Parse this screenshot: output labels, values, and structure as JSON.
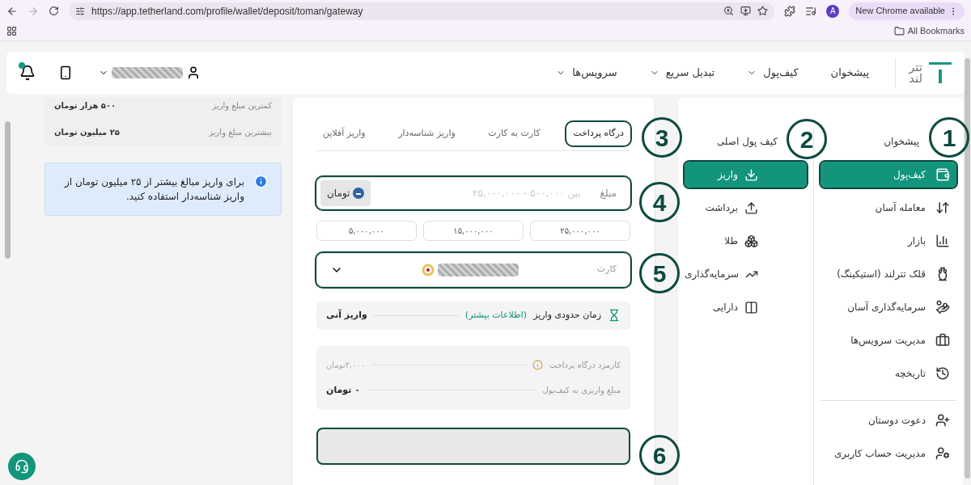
{
  "browser": {
    "url": "https://app.tetherland.com/profile/wallet/deposit/toman/gateway",
    "profile_initial": "A",
    "update_button": "New Chrome available",
    "bookmarks": "All Bookmarks"
  },
  "header": {
    "logo": [
      "تتر",
      "لند"
    ],
    "notification_dot": true,
    "nav": [
      {
        "label": "پیشخوان",
        "dropdown": false
      },
      {
        "label": "کیف‌پول",
        "dropdown": true
      },
      {
        "label": "تبدیل سریع",
        "dropdown": true
      },
      {
        "label": "سرویس‌ها",
        "dropdown": true
      }
    ]
  },
  "sidebar": {
    "items": [
      {
        "label": "پیشخوان",
        "selected": false
      },
      {
        "label": "کیف‌پول",
        "selected": true
      },
      {
        "label": "معامله آسان",
        "selected": false
      },
      {
        "label": "بازار",
        "selected": false
      },
      {
        "label": "قلک تترلند (استیکینگ)",
        "selected": false
      },
      {
        "label": "سرمایه‌گذاری آسان",
        "selected": false
      },
      {
        "label": "مدیریت سرویس‌ها",
        "selected": false
      },
      {
        "label": "تاریخچه",
        "selected": false
      }
    ],
    "bottom_items": [
      {
        "label": "دعوت دوستان"
      },
      {
        "label": "مدیریت حساب کاربری"
      }
    ]
  },
  "submenu": {
    "title": "کیف پول اصلی",
    "items": [
      {
        "label": "واریز",
        "selected": true
      },
      {
        "label": "برداشت",
        "selected": false
      },
      {
        "label": "طلا",
        "selected": false
      },
      {
        "label": "سرمایه‌گذاری",
        "selected": false
      },
      {
        "label": "دارایی",
        "selected": false
      }
    ]
  },
  "tabs": [
    {
      "label": "درگاه پرداخت",
      "selected": true
    },
    {
      "label": "کارت به کارت",
      "selected": false
    },
    {
      "label": "واریز شناسه‌دار",
      "selected": false
    },
    {
      "label": "واریز آفلاین",
      "selected": false
    }
  ],
  "amount_field": {
    "label": "مبلغ",
    "placeholder": "بین ۵۰۰,۰۰۰ - ۲۵,۰۰۰,۰۰۰",
    "currency": "تومان"
  },
  "presets": [
    "۲۵,۰۰۰,۰۰۰",
    "۱۵,۰۰۰,۰۰۰",
    "۵,۰۰۰,۰۰۰"
  ],
  "card_select": {
    "label": "کارت"
  },
  "eta": {
    "label": "زمان حدودی واریز",
    "link": "(اطلاعات بیشتر)",
    "value": "واریز آنی"
  },
  "summary": [
    {
      "label": "کارمزد درگاه پرداخت",
      "value": "۴,۰۰۰تومان",
      "muted": true,
      "info": true
    },
    {
      "label": "مبلغ واریزی به کیف‌پول",
      "value": "۰ تومان",
      "muted": false,
      "info": false
    }
  ],
  "submit": {
    "disabled": true
  },
  "limits": [
    {
      "label": "کمترین مبلغ واریز",
      "value": "۵۰۰ هزار تومان"
    },
    {
      "label": "بیشترین مبلغ واریز",
      "value": "۲۵ میلیون تومان"
    }
  ],
  "alert": "برای واریز مبالغ بیشتر از ۲۵ میلیون تومان از واریز شناسه‌دار استفاده کنید.",
  "annotations": [
    "1",
    "2",
    "3",
    "4",
    "5",
    "6"
  ]
}
